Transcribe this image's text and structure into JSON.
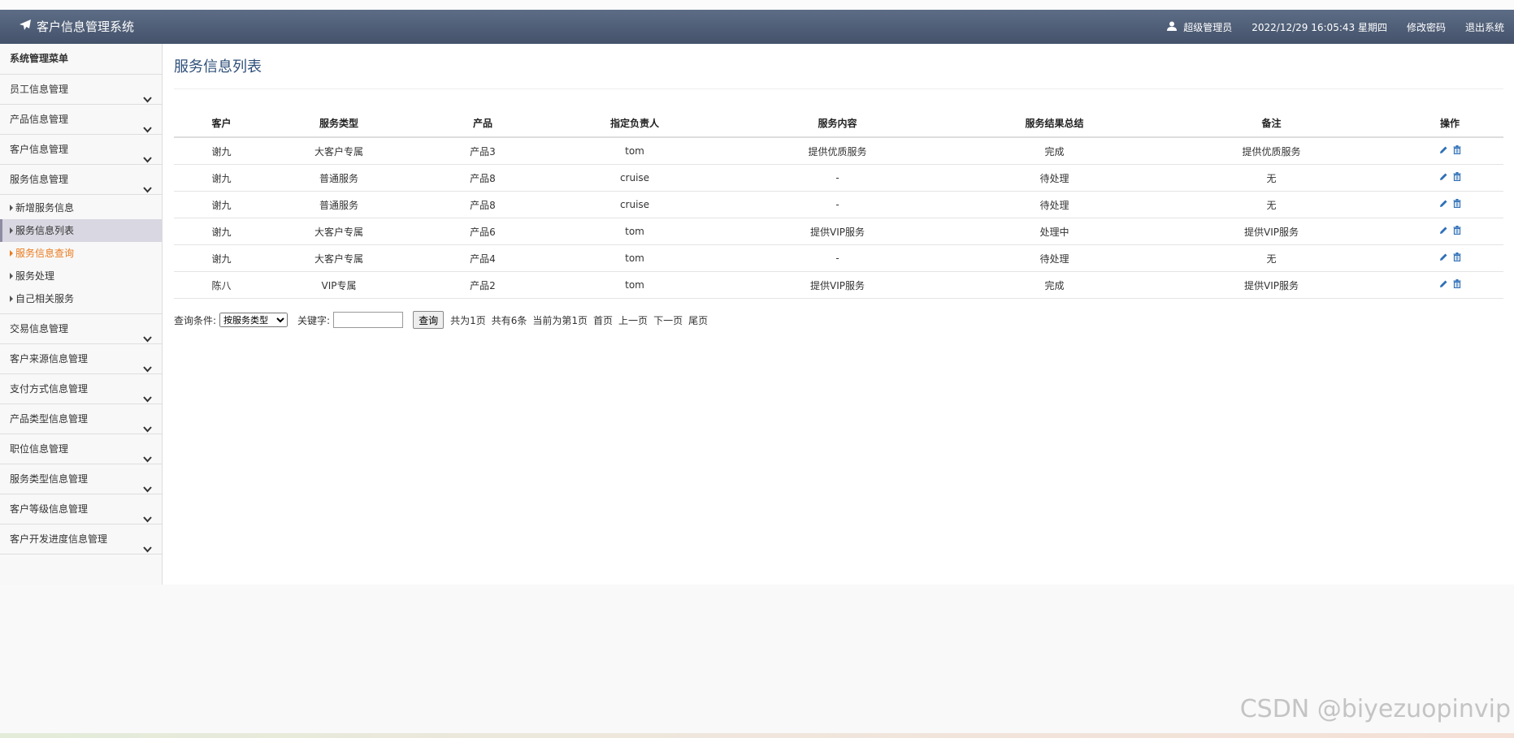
{
  "header": {
    "title": "客户信息管理系统",
    "user": "超级管理员",
    "datetime": "2022/12/29 16:05:43 星期四",
    "change_password": "修改密码",
    "logout": "退出系统"
  },
  "sidebar": {
    "heading": "系统管理菜单",
    "groups_top": [
      {
        "label": "员工信息管理"
      },
      {
        "label": "产品信息管理"
      },
      {
        "label": "客户信息管理"
      },
      {
        "label": "服务信息管理"
      }
    ],
    "sub_items": [
      {
        "label": "新增服务信息"
      },
      {
        "label": "服务信息列表"
      },
      {
        "label": "服务信息查询"
      },
      {
        "label": "服务处理"
      },
      {
        "label": "自己相关服务"
      }
    ],
    "groups_bottom": [
      {
        "label": "交易信息管理"
      },
      {
        "label": "客户来源信息管理"
      },
      {
        "label": "支付方式信息管理"
      },
      {
        "label": "产品类型信息管理"
      },
      {
        "label": "职位信息管理"
      },
      {
        "label": "服务类型信息管理"
      },
      {
        "label": "客户等级信息管理"
      },
      {
        "label": "客户开发进度信息管理"
      }
    ]
  },
  "main": {
    "page_title": "服务信息列表",
    "columns": [
      "客户",
      "服务类型",
      "产品",
      "指定负责人",
      "服务内容",
      "服务结果总结",
      "备注",
      "操作"
    ],
    "rows": [
      [
        "谢九",
        "大客户专属",
        "产品3",
        "tom",
        "提供优质服务",
        "完成",
        "提供优质服务"
      ],
      [
        "谢九",
        "普通服务",
        "产品8",
        "cruise",
        "-",
        "待处理",
        "无"
      ],
      [
        "谢九",
        "普通服务",
        "产品8",
        "cruise",
        "-",
        "待处理",
        "无"
      ],
      [
        "谢九",
        "大客户专属",
        "产品6",
        "tom",
        "提供VIP服务",
        "处理中",
        "提供VIP服务"
      ],
      [
        "谢九",
        "大客户专属",
        "产品4",
        "tom",
        "-",
        "待处理",
        "无"
      ],
      [
        "陈八",
        "VIP专属",
        "产品2",
        "tom",
        "提供VIP服务",
        "完成",
        "提供VIP服务"
      ]
    ]
  },
  "search": {
    "condition_label": "查询条件:",
    "condition_selected": "按服务类型",
    "keyword_label": "关键字:",
    "keyword_value": "",
    "query_button": "查询",
    "total_pages": "共为1页",
    "total_records": "共有6条",
    "current_page": "当前为第1页",
    "first": "首页",
    "prev": "上一页",
    "next": "下一页",
    "last": "尾页"
  },
  "watermark": "CSDN @biyezuopinvip",
  "colors": {
    "navbar": "#4f5e77",
    "title": "#2f4f7a",
    "highlight": "#ea7b1f",
    "icon": "#2e6fb7"
  }
}
